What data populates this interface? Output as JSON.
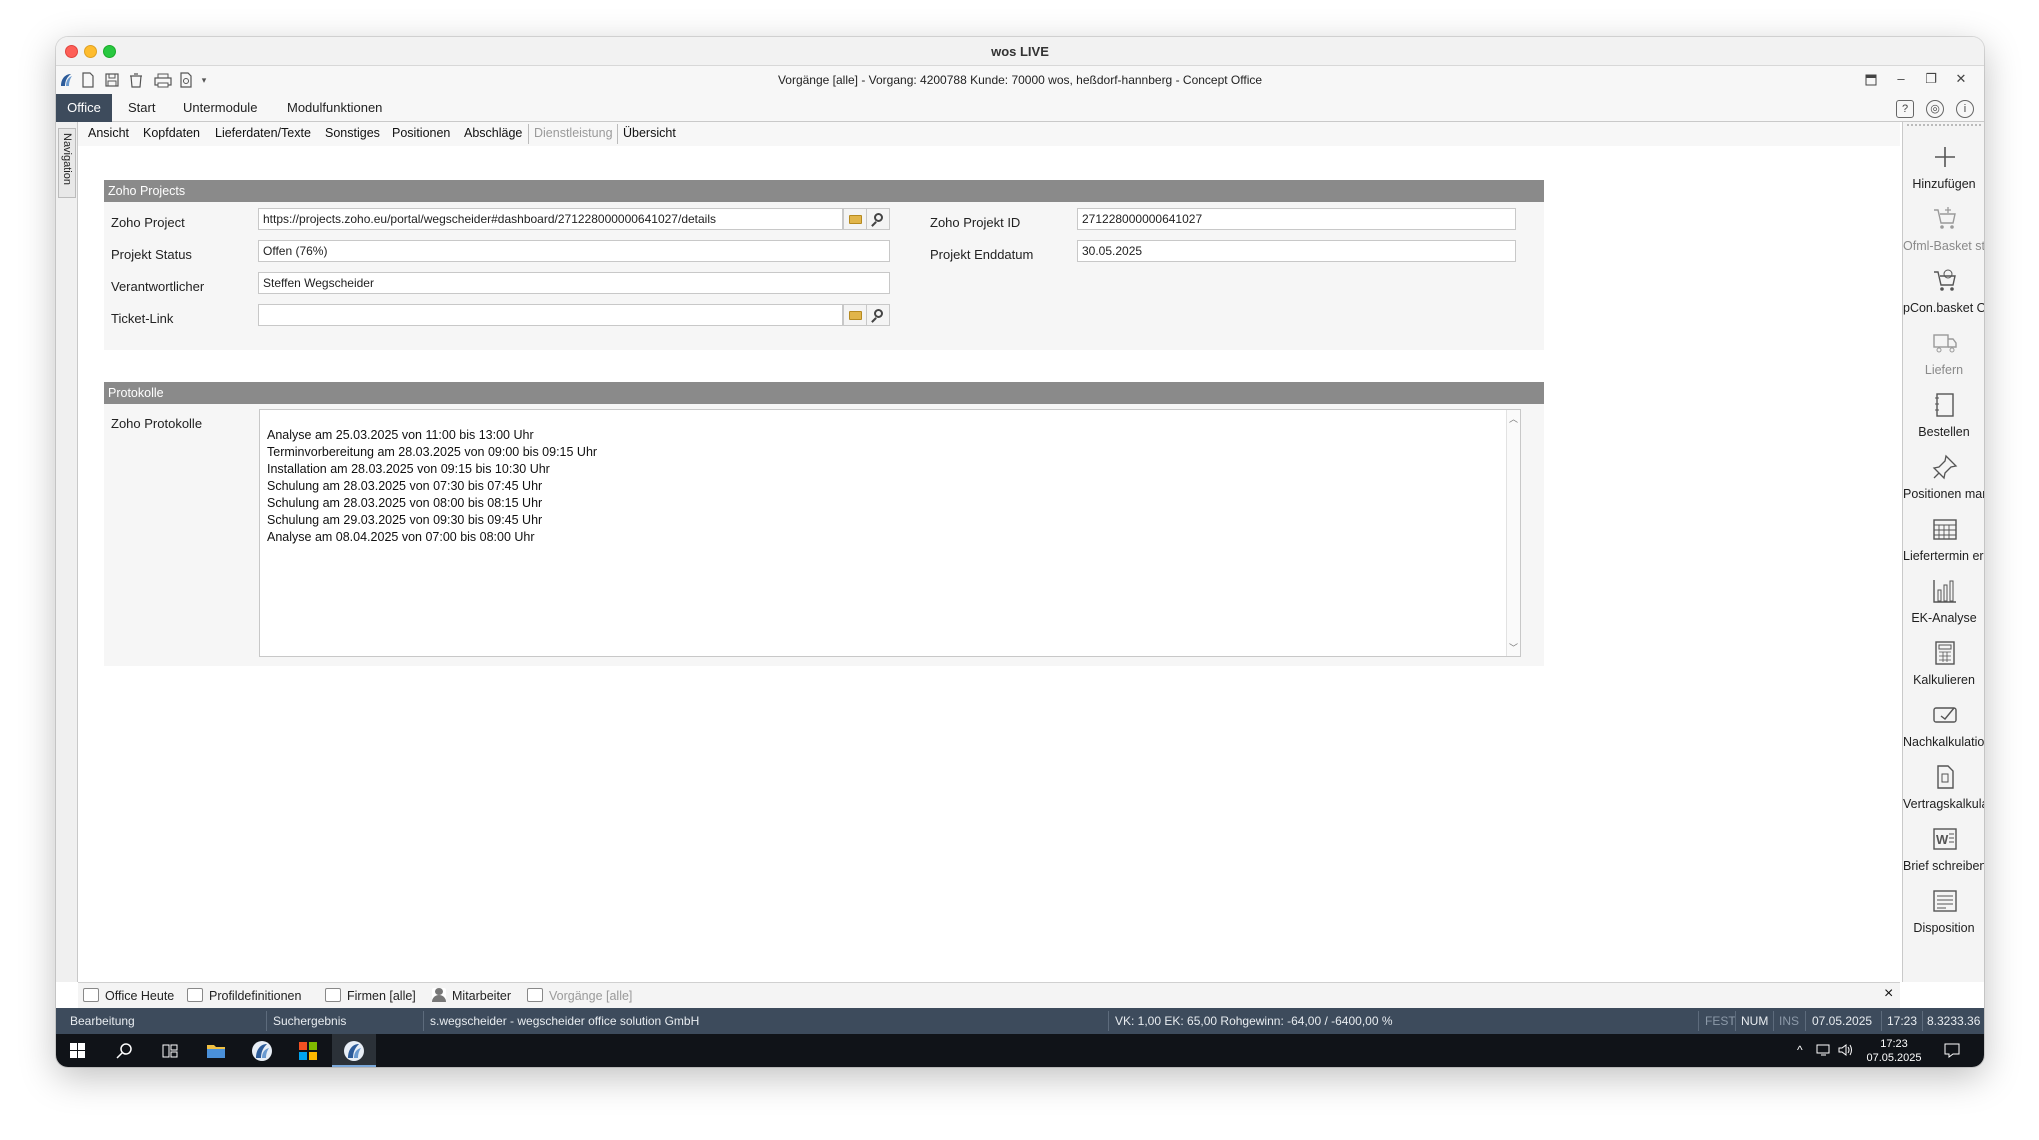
{
  "window": {
    "title": "wos LIVE",
    "app_title": "Vorgänge [alle] - Vorgang: 4200788 Kunde: 70000 wos, heßdorf-hannberg - Concept Office"
  },
  "menu": {
    "items": [
      "Office",
      "Start",
      "Untermodule",
      "Modulfunktionen"
    ]
  },
  "navigation": {
    "label": "Navigation"
  },
  "subtabs": [
    "Ansicht",
    "Kopfdaten",
    "Lieferdaten/Texte",
    "Sonstiges",
    "Positionen",
    "Abschläge",
    "Dienstleistung",
    "Übersicht"
  ],
  "zoho": {
    "section_title": "Zoho Projects",
    "project_label": "Zoho Project",
    "project_url": "https://projects.zoho.eu/portal/wegscheider#dashboard/271228000000641027/details",
    "status_label": "Projekt Status",
    "status_value": "Offen (76%)",
    "owner_label": "Verantwortlicher",
    "owner_value": "Steffen Wegscheider",
    "ticket_label": "Ticket-Link",
    "ticket_value": "",
    "project_id_label": "Zoho Projekt ID",
    "project_id_value": "271228000000641027",
    "end_date_label": "Projekt Enddatum",
    "end_date_value": "30.05.2025"
  },
  "protocols": {
    "section_title": "Protokolle",
    "label": "Zoho Protokolle",
    "lines": [
      "Analyse am 25.03.2025 von 11:00 bis 13:00 Uhr",
      "Terminvorbereitung am 28.03.2025 von 09:00 bis 09:15 Uhr",
      "Installation am 28.03.2025 von 09:15 bis 10:30 Uhr",
      "Schulung am 28.03.2025 von 07:30 bis 07:45 Uhr",
      "Schulung am 28.03.2025 von 08:00 bis 08:15 Uhr",
      "Schulung am 29.03.2025 von 09:30 bis 09:45 Uhr",
      "Analyse am 08.04.2025 von 07:00 bis 08:00 Uhr"
    ]
  },
  "actions": [
    {
      "label": "Hinzufügen",
      "icon": "plus-icon",
      "enabled": true
    },
    {
      "label": "Ofml-Basket starten",
      "icon": "cart-icon",
      "enabled": false
    },
    {
      "label": "pCon.basket Online",
      "icon": "cart-online-icon",
      "enabled": true
    },
    {
      "label": "Liefern",
      "icon": "truck-icon",
      "enabled": false
    },
    {
      "label": "Bestellen",
      "icon": "order-icon",
      "enabled": true
    },
    {
      "label": "Positionen markieren",
      "icon": "pin-icon",
      "enabled": true
    },
    {
      "label": "Liefertermin ermitteln",
      "icon": "calendar-icon",
      "enabled": true
    },
    {
      "label": "EK-Analyse",
      "icon": "bar-chart-icon",
      "enabled": true
    },
    {
      "label": "Kalkulieren",
      "icon": "calculator-icon",
      "enabled": true
    },
    {
      "label": "Nachkalkulation",
      "icon": "recalc-icon",
      "enabled": true
    },
    {
      "label": "Vertragskalkulation",
      "icon": "contract-icon",
      "enabled": true
    },
    {
      "label": "Brief schreiben",
      "icon": "word-icon",
      "enabled": true
    },
    {
      "label": "Disposition",
      "icon": "disposition-icon",
      "enabled": true
    }
  ],
  "doc_tabs": [
    {
      "label": "Office Heute",
      "icon": "calendar-icon",
      "enabled": true
    },
    {
      "label": "Profildefinitionen",
      "icon": "profile-icon",
      "enabled": true
    },
    {
      "label": "Firmen [alle]",
      "icon": "company-icon",
      "enabled": true
    },
    {
      "label": "Mitarbeiter",
      "icon": "person-icon",
      "enabled": true
    },
    {
      "label": "Vorgänge [alle]",
      "icon": "document-icon",
      "enabled": false
    }
  ],
  "doc_tabs_close": "×",
  "status": {
    "mode": "Bearbeitung",
    "search": "Suchergebnis",
    "user": "s.wegscheider - wegscheider office solution GmbH",
    "calc": "VK: 1,00 EK: 65,00 Rohgewinn: -64,00  /  -6400,00 %",
    "fest": "FEST",
    "num": "NUM",
    "ins": "INS",
    "date": "07.05.2025",
    "time": "17:23",
    "version": "8.3233.36"
  },
  "taskbar": {
    "time": "17:23",
    "date": "07.05.2025"
  },
  "colors": {
    "accent": "#3d4b5c",
    "section_header": "#8a8a8a",
    "taskbar": "#101318"
  }
}
